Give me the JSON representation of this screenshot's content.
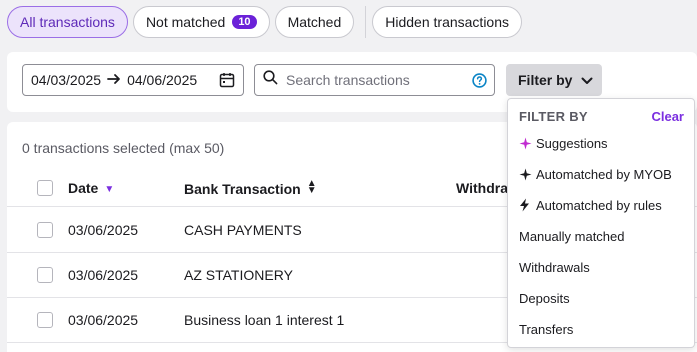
{
  "tabs": {
    "all": "All transactions",
    "not_matched": "Not matched",
    "not_matched_count": "10",
    "matched": "Matched",
    "hidden": "Hidden transactions"
  },
  "toolbar": {
    "date_from": "04/03/2025",
    "date_to": "04/06/2025",
    "search_placeholder": "Search transactions",
    "filter_label": "Filter by"
  },
  "table": {
    "selection_info": "0 transactions selected (max 50)",
    "columns": {
      "date": "Date",
      "bank": "Bank Transaction",
      "withdrawals": "Withdra"
    },
    "rows": [
      {
        "date": "03/06/2025",
        "bank": "CASH PAYMENTS"
      },
      {
        "date": "03/06/2025",
        "bank": "AZ STATIONERY"
      },
      {
        "date": "03/06/2025",
        "bank": "Business loan 1 interest 1"
      }
    ]
  },
  "filter_menu": {
    "title": "FILTER BY",
    "clear": "Clear",
    "items": [
      {
        "label": "Suggestions",
        "icon": "sparkle-purple-icon"
      },
      {
        "label": "Automatched by MYOB",
        "icon": "sparkle-black-icon"
      },
      {
        "label": "Automatched by rules",
        "icon": "lightning-icon"
      },
      {
        "label": "Manually matched"
      },
      {
        "label": "Withdrawals"
      },
      {
        "label": "Deposits"
      },
      {
        "label": "Transfers"
      }
    ]
  },
  "colors": {
    "accent": "#7b2fe0",
    "active_tab_bg": "#ece3fb",
    "badge": "#6b21d8"
  }
}
